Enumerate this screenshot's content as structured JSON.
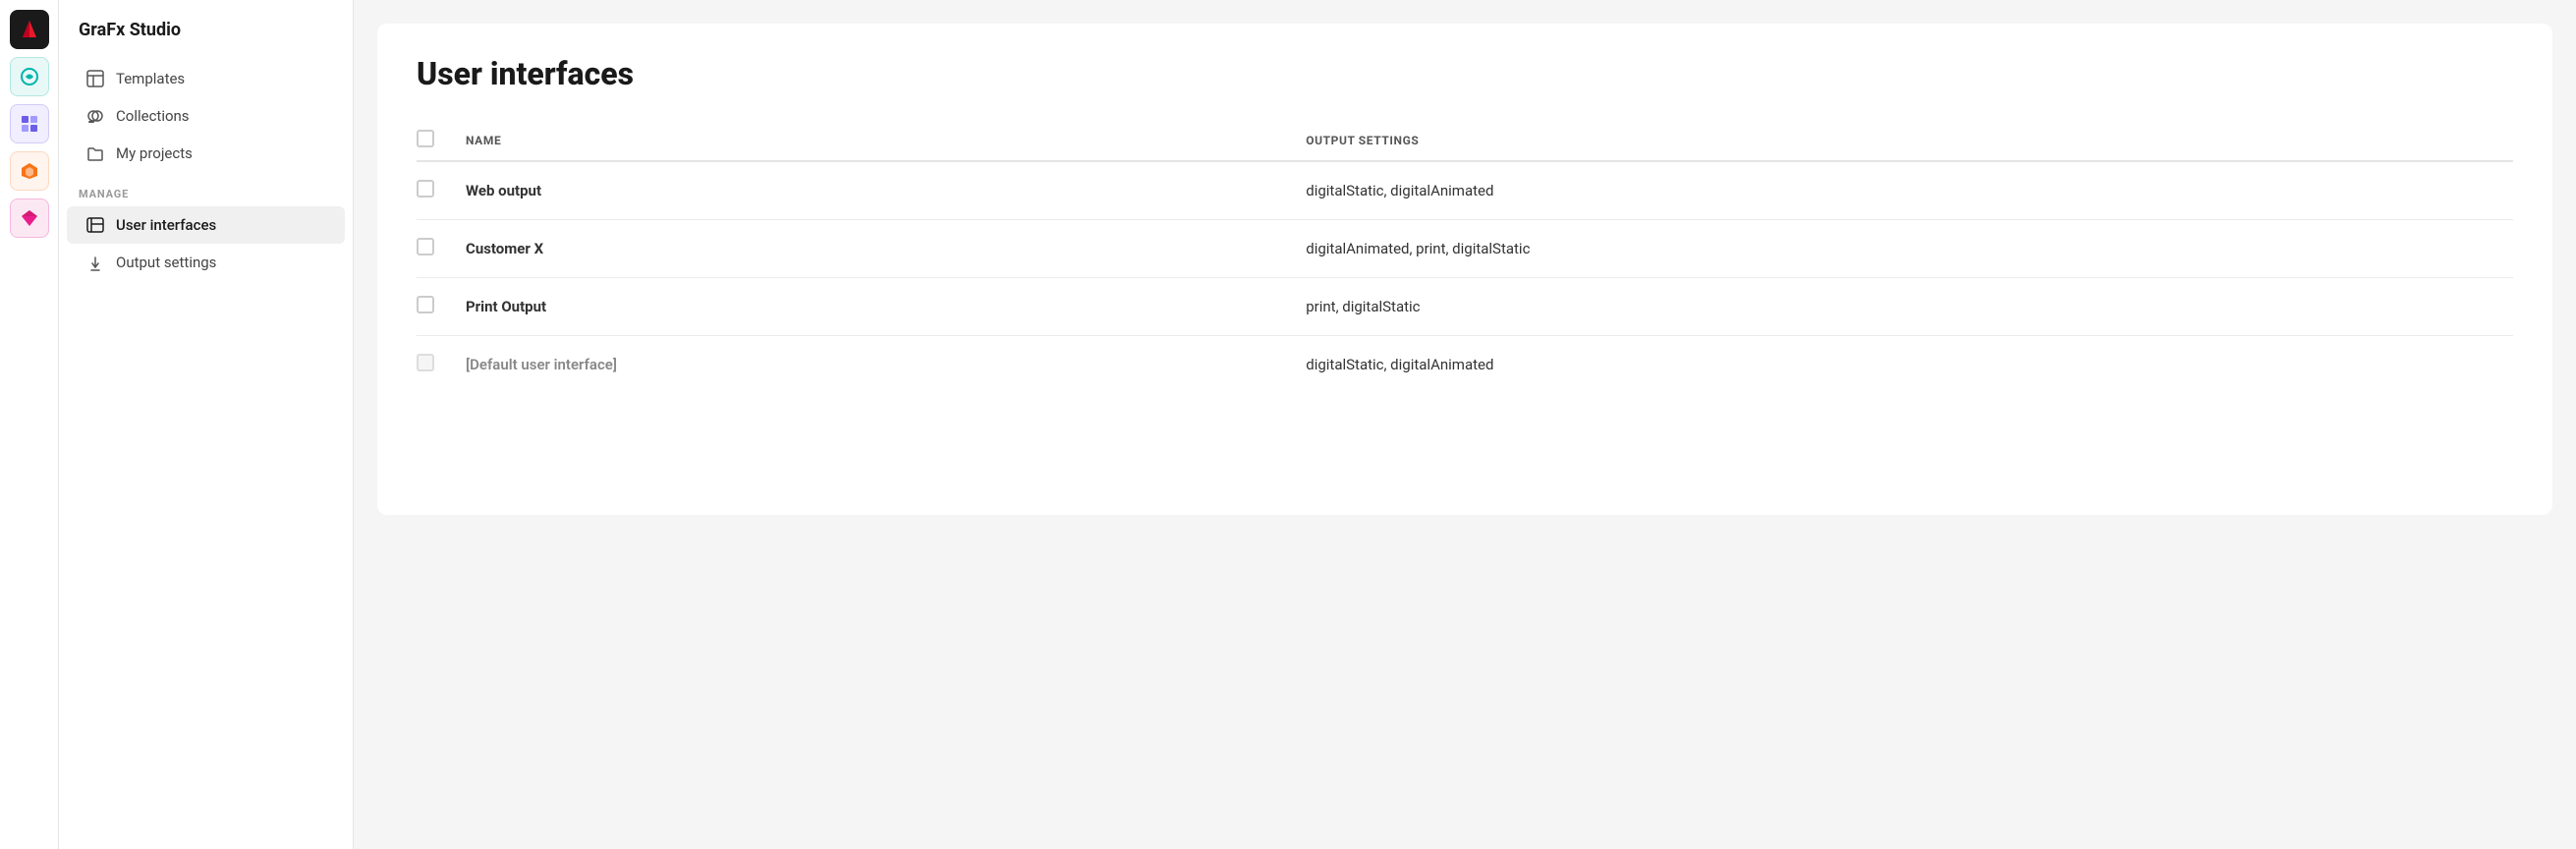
{
  "app": {
    "title": "GraFx Studio"
  },
  "iconBar": {
    "icons": [
      {
        "name": "grafx-logo-icon",
        "color": "#e8192c"
      },
      {
        "name": "studio-icon",
        "color": "#00b5ad"
      },
      {
        "name": "creative-icon",
        "color": "#6c5ce7"
      },
      {
        "name": "frontify-icon",
        "color": "#f97316"
      },
      {
        "name": "gem-icon",
        "color": "#e91e8c"
      }
    ]
  },
  "sidebar": {
    "title": "GraFx Studio",
    "navItems": [
      {
        "label": "Templates",
        "icon": "templates-icon",
        "active": false
      },
      {
        "label": "Collections",
        "icon": "collections-icon",
        "active": false
      },
      {
        "label": "My projects",
        "icon": "projects-icon",
        "active": false
      }
    ],
    "manageLabel": "MANAGE",
    "manageItems": [
      {
        "label": "User interfaces",
        "icon": "user-interfaces-icon",
        "active": true
      },
      {
        "label": "Output settings",
        "icon": "output-settings-icon",
        "active": false
      }
    ]
  },
  "main": {
    "pageTitle": "User interfaces",
    "table": {
      "columns": [
        {
          "key": "checkbox",
          "label": ""
        },
        {
          "key": "name",
          "label": "NAME"
        },
        {
          "key": "outputSettings",
          "label": "OUTPUT SETTINGS"
        }
      ],
      "rows": [
        {
          "name": "Web output",
          "outputSettings": "digitalStatic, digitalAnimated",
          "isDefault": false
        },
        {
          "name": "Customer X",
          "outputSettings": "digitalAnimated, print, digitalStatic",
          "isDefault": false
        },
        {
          "name": "Print Output",
          "outputSettings": "print, digitalStatic",
          "isDefault": false
        },
        {
          "name": "[Default user interface]",
          "outputSettings": "digitalStatic, digitalAnimated",
          "isDefault": true
        }
      ]
    }
  }
}
